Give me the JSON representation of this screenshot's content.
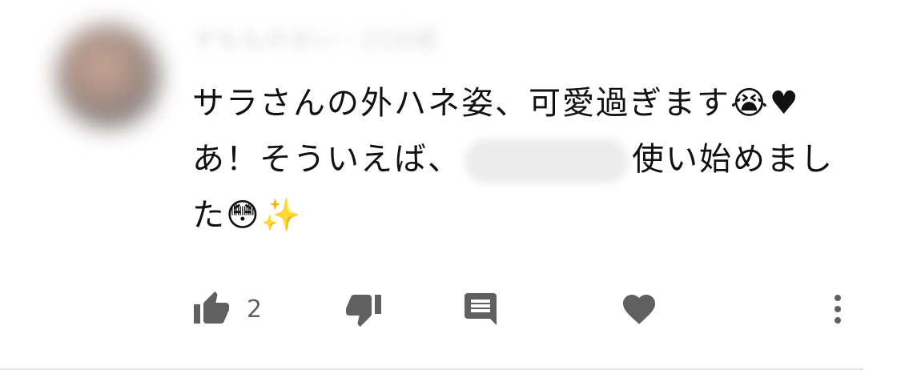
{
  "comment": {
    "author": "すもものまい・25分前",
    "lines": [
      "サラさんの外ハネ姿、可愛過ぎます😭♥",
      "あ！そういえば、",
      "使い始めまし",
      "た😳✨"
    ]
  },
  "actions": {
    "like_count": "2"
  },
  "icons": {
    "like": "thumb-up-icon",
    "dislike": "thumb-down-icon",
    "reply": "reply-comment-icon",
    "heart": "heart-icon",
    "more": "more-vertical-icon"
  },
  "colors": {
    "text": "#111111",
    "icon": "#606060",
    "background": "#ffffff"
  }
}
